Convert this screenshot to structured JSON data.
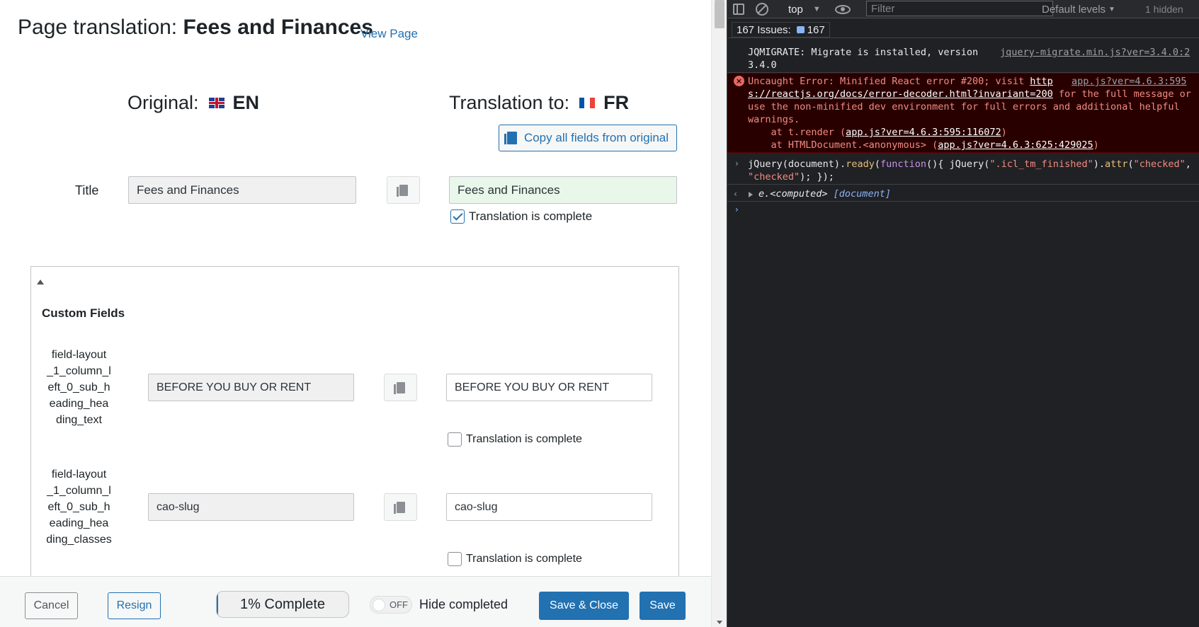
{
  "page": {
    "heading_prefix": "Page translation: ",
    "heading_title": "Fees and Finances",
    "view_link": "View Page"
  },
  "languages": {
    "original_label": "Original:",
    "original_code": "EN",
    "translation_label": "Translation to:",
    "translation_code": "FR"
  },
  "copy_all_label": "Copy all fields from original",
  "title_row": {
    "label": "Title",
    "original": "Fees and Finances",
    "translation": "Fees and Finances",
    "complete_label": "Translation is complete",
    "complete": true
  },
  "custom_fields": {
    "title": "Custom Fields",
    "rows": [
      {
        "label_lines": [
          "field-layout",
          "_1_column_l",
          "eft_0_sub_h",
          "eading_hea",
          "ding_text"
        ],
        "original": "BEFORE YOU BUY OR RENT",
        "translation": "BEFORE YOU BUY OR RENT",
        "complete_label": "Translation is complete",
        "complete": false
      },
      {
        "label_lines": [
          "field-layout",
          "_1_column_l",
          "eft_0_sub_h",
          "eading_hea",
          "ding_classes"
        ],
        "original": "cao-slug",
        "translation": "cao-slug",
        "complete_label": "Translation is complete",
        "complete": false
      }
    ]
  },
  "footer": {
    "cancel": "Cancel",
    "resign": "Resign",
    "progress_text": "1% Complete",
    "progress_percent": 1,
    "toggle_state": "OFF",
    "hide_completed": "Hide completed",
    "save_close": "Save & Close",
    "save": "Save"
  },
  "devtools": {
    "context": "top",
    "filter_placeholder": "Filter",
    "levels": "Default levels",
    "hidden": "1 hidden",
    "issues_label": "167 Issues:",
    "issues_count": "167",
    "info_msg_1": "JQMIGRATE: Migrate is installed, version",
    "info_msg_2": "3.4.0",
    "info_src": "jquery-migrate.min.js?ver=3.4.0:2",
    "err_line1_a": "Uncaught Error: Minified React error #200; visit ",
    "err_line1_link": "http",
    "err_line2_link": "s://reactjs.org/docs/error-decoder.html?invariant=200",
    "err_line2_rest": " for the full message or",
    "err_line3": "use the non-minified dev environment for full errors and additional helpful",
    "err_line4": "warnings.",
    "err_at1_a": "    at t.render (",
    "err_at1_link": "app.js?ver=4.6.3:595:116072",
    "err_at1_b": ")",
    "err_at2_a": "    at HTMLDocument.<anonymous> (",
    "err_at2_link": "app.js?ver=4.6.3:625:429025",
    "err_at2_b": ")",
    "err_src": "app.js?ver=4.6.3:595",
    "result_prefix": "e.<computed> ",
    "result_doc": "[document]"
  },
  "colors": {
    "accent": "#2271b1",
    "complete_bg": "#e9f7ea",
    "devtools_bg": "#202124",
    "error_bg": "#290000",
    "error_text": "#f28b82"
  }
}
